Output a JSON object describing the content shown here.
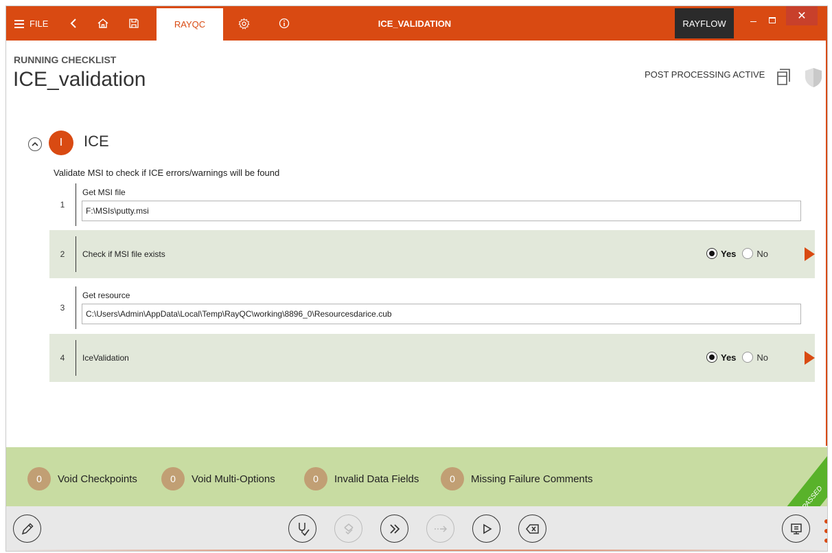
{
  "titlebar": {
    "file_label": "FILE",
    "active_tab": "RAYQC",
    "window_title": "ICE_VALIDATION",
    "rayflow_label": "RAYFLOW",
    "close_glyph": "✕",
    "icons": [
      "menu-icon",
      "back-icon",
      "home-icon",
      "save-icon",
      "gear-icon",
      "info-icon",
      "minimize-icon",
      "maximize-icon",
      "close-icon"
    ]
  },
  "header": {
    "subtitle": "RUNNING CHECKLIST",
    "title": "ICE_validation",
    "post_processing": "POST PROCESSING ACTIVE"
  },
  "section": {
    "badge": "I",
    "title": "ICE",
    "description": "Validate MSI to check if ICE errors/warnings will be found"
  },
  "steps": [
    {
      "number": "1",
      "label": "Get MSI file",
      "value": "F:\\MSIs\\putty.msi"
    },
    {
      "number": "2",
      "label": "Check if MSI file exists",
      "yes_label": "Yes",
      "no_label": "No",
      "selected": "Yes"
    },
    {
      "number": "3",
      "label": "Get resource",
      "value": "C:\\Users\\Admin\\AppData\\Local\\Temp\\RayQC\\working\\8896_0\\Resourcesdarice.cub"
    },
    {
      "number": "4",
      "label": "IceValidation",
      "yes_label": "Yes",
      "no_label": "No",
      "selected": "Yes"
    }
  ],
  "status": {
    "void_checkpoints": {
      "count": "0",
      "label": "Void Checkpoints"
    },
    "void_multi_options": {
      "count": "0",
      "label": "Void Multi-Options"
    },
    "invalid_data_fields": {
      "count": "0",
      "label": "Invalid Data Fields"
    },
    "missing_failure_comments": {
      "count": "0",
      "label": "Missing Failure Comments"
    },
    "ribbon": "PASSED"
  },
  "toolbar": {
    "buttons": [
      "edit-icon",
      "check-pass-icon",
      "check-multi-icon",
      "fast-forward-icon",
      "skip-icon",
      "play-icon",
      "clear-icon",
      "screen-icon"
    ]
  },
  "colors": {
    "accent": "#d94a12",
    "shaded_row": "#e2e8da",
    "status_bar": "#c8dca2",
    "count_badge": "#c19f74",
    "ribbon": "#59b22a"
  }
}
